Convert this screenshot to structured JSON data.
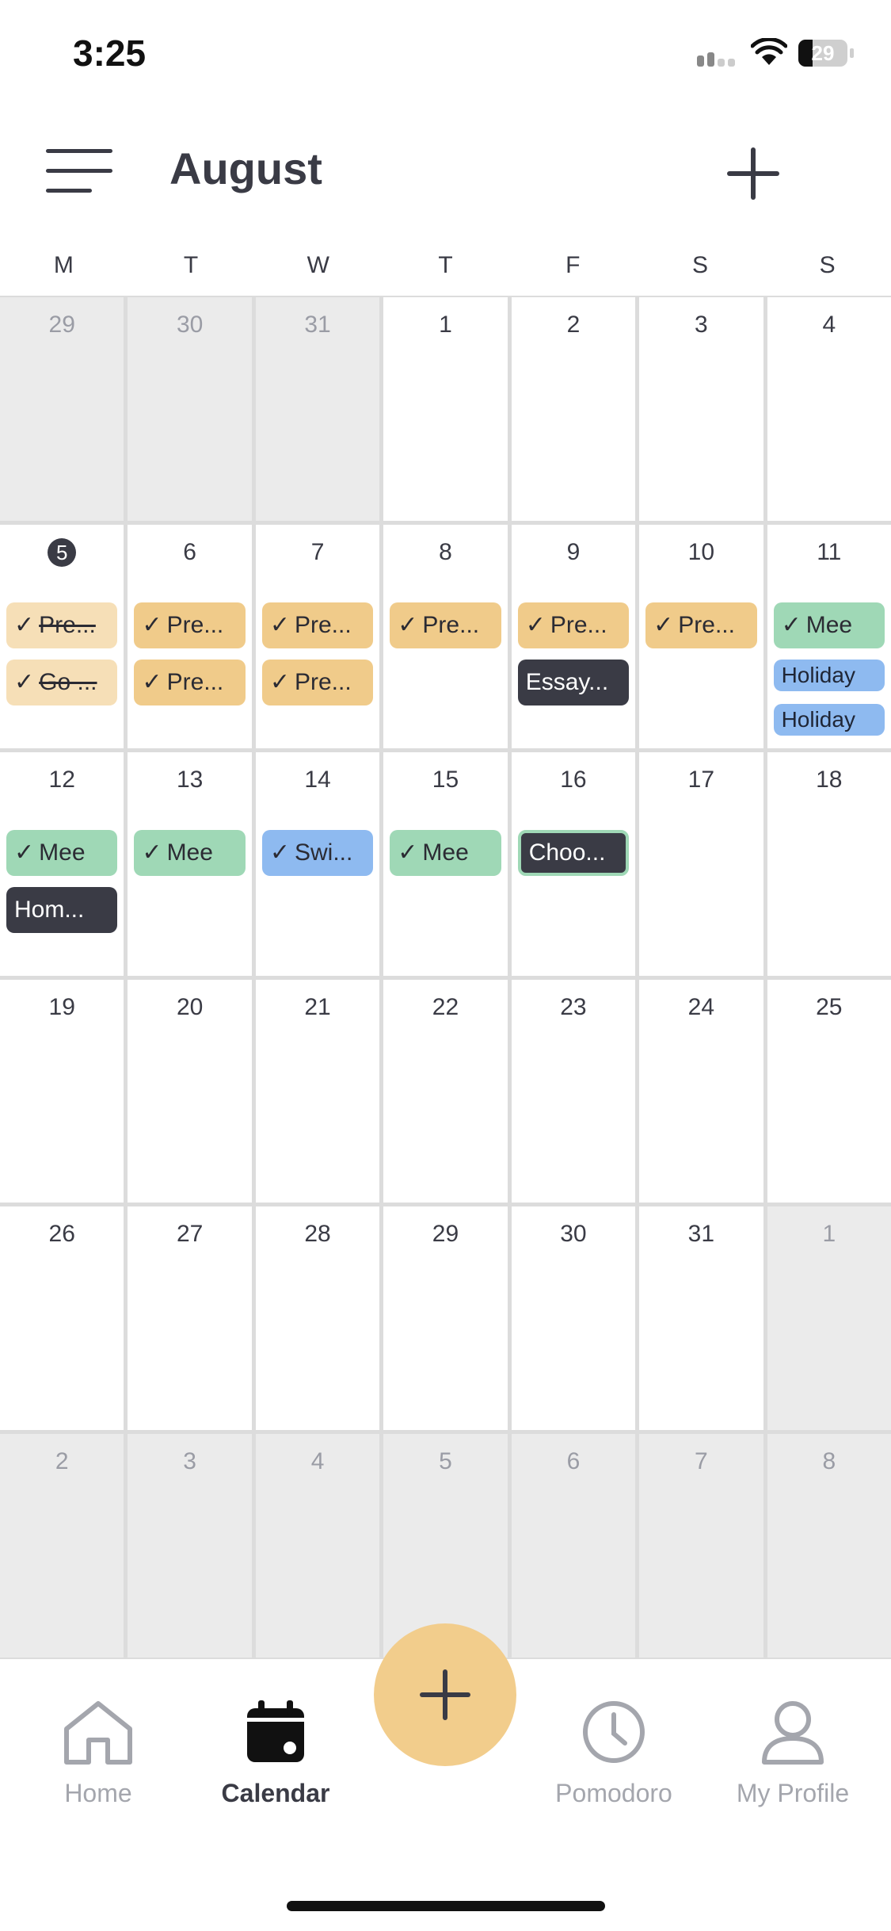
{
  "status_bar": {
    "time": "3:25",
    "battery": "29",
    "battery_level": 0.29
  },
  "header": {
    "month": "August"
  },
  "weekdays": [
    "M",
    "T",
    "W",
    "T",
    "F",
    "S",
    "S"
  ],
  "weeks": [
    [
      {
        "day": "29",
        "out": true,
        "events": []
      },
      {
        "day": "30",
        "out": true,
        "events": []
      },
      {
        "day": "31",
        "out": true,
        "events": []
      },
      {
        "day": "1",
        "events": []
      },
      {
        "day": "2",
        "events": []
      },
      {
        "day": "3",
        "events": []
      },
      {
        "day": "4",
        "events": []
      }
    ],
    [
      {
        "day": "5",
        "today": true,
        "events": [
          {
            "type": "done",
            "check": true,
            "text": "Pre..."
          },
          {
            "type": "done",
            "check": true,
            "text": "Go ..."
          }
        ]
      },
      {
        "day": "6",
        "events": [
          {
            "type": "task",
            "check": true,
            "text": "Pre..."
          },
          {
            "type": "task",
            "check": true,
            "text": "Pre..."
          }
        ]
      },
      {
        "day": "7",
        "events": [
          {
            "type": "task",
            "check": true,
            "text": "Pre..."
          },
          {
            "type": "task",
            "check": true,
            "text": "Pre..."
          }
        ]
      },
      {
        "day": "8",
        "events": [
          {
            "type": "task",
            "check": true,
            "text": "Pre..."
          }
        ]
      },
      {
        "day": "9",
        "events": [
          {
            "type": "task",
            "check": true,
            "text": "Pre..."
          },
          {
            "type": "dark",
            "text": "Essay..."
          }
        ]
      },
      {
        "day": "10",
        "events": [
          {
            "type": "task",
            "check": true,
            "text": "Pre..."
          }
        ]
      },
      {
        "day": "11",
        "events": [
          {
            "type": "meet",
            "check": true,
            "text": "Mee"
          },
          {
            "type": "holiday",
            "text": "Holiday"
          },
          {
            "type": "holiday",
            "text": "Holiday"
          }
        ]
      }
    ],
    [
      {
        "day": "12",
        "events": [
          {
            "type": "meet",
            "check": true,
            "text": "Mee"
          },
          {
            "type": "dark",
            "text": "Hom..."
          }
        ]
      },
      {
        "day": "13",
        "events": [
          {
            "type": "meet",
            "check": true,
            "text": "Mee"
          }
        ]
      },
      {
        "day": "14",
        "events": [
          {
            "type": "blue",
            "check": true,
            "text": "Swi..."
          }
        ]
      },
      {
        "day": "15",
        "events": [
          {
            "type": "meet",
            "check": true,
            "text": "Mee"
          }
        ]
      },
      {
        "day": "16",
        "events": [
          {
            "type": "dark-bordered",
            "text": "Choo..."
          }
        ]
      },
      {
        "day": "17",
        "events": []
      },
      {
        "day": "18",
        "events": []
      }
    ],
    [
      {
        "day": "19",
        "events": []
      },
      {
        "day": "20",
        "events": []
      },
      {
        "day": "21",
        "events": []
      },
      {
        "day": "22",
        "events": []
      },
      {
        "day": "23",
        "events": []
      },
      {
        "day": "24",
        "events": []
      },
      {
        "day": "25",
        "events": []
      }
    ],
    [
      {
        "day": "26",
        "events": []
      },
      {
        "day": "27",
        "events": []
      },
      {
        "day": "28",
        "events": []
      },
      {
        "day": "29",
        "events": []
      },
      {
        "day": "30",
        "events": []
      },
      {
        "day": "31",
        "events": []
      },
      {
        "day": "1",
        "out": true,
        "events": []
      }
    ],
    [
      {
        "day": "2",
        "out": true,
        "events": []
      },
      {
        "day": "3",
        "out": true,
        "events": []
      },
      {
        "day": "4",
        "out": true,
        "events": []
      },
      {
        "day": "5",
        "out": true,
        "events": []
      },
      {
        "day": "6",
        "out": true,
        "events": []
      },
      {
        "day": "7",
        "out": true,
        "events": []
      },
      {
        "day": "8",
        "out": true,
        "events": []
      }
    ]
  ],
  "check_glyph": "✓",
  "tabs": [
    {
      "id": "home",
      "label": "Home",
      "icon": "home-icon",
      "active": false
    },
    {
      "id": "calendar",
      "label": "Calendar",
      "icon": "calendar-icon",
      "active": true
    },
    {
      "id": "pomodoro",
      "label": "Pomodoro",
      "icon": "clock-icon",
      "active": false
    },
    {
      "id": "profile",
      "label": "My Profile",
      "icon": "user-icon",
      "active": false
    }
  ],
  "colors": {
    "text_dark": "#3a3b45",
    "task": "#f0cb8a",
    "task_done": "#f6dfb7",
    "meeting": "#9fd8b6",
    "holiday": "#8ebaf0",
    "dark_event": "#3a3b45",
    "fab": "#f2cd8c",
    "inactive_tab": "#a4a6ad"
  }
}
